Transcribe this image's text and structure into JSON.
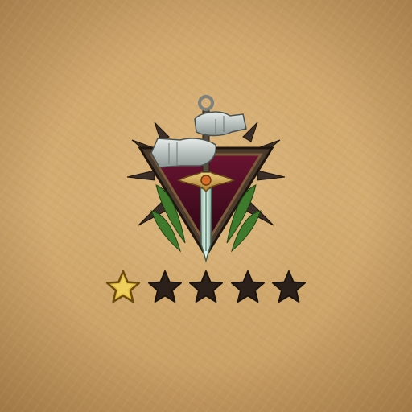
{
  "rank_emblem": {
    "icon": "sword-crest-icon",
    "colors": {
      "shield": "#4a0d22",
      "blade": "#cfe3d6",
      "leaves": "#3f7a2c",
      "gauntlet": "#b9c2c0"
    }
  },
  "rating": {
    "value": 1,
    "max": 5,
    "filled_color": "#e0b83a",
    "empty_color": "#2b211a"
  }
}
